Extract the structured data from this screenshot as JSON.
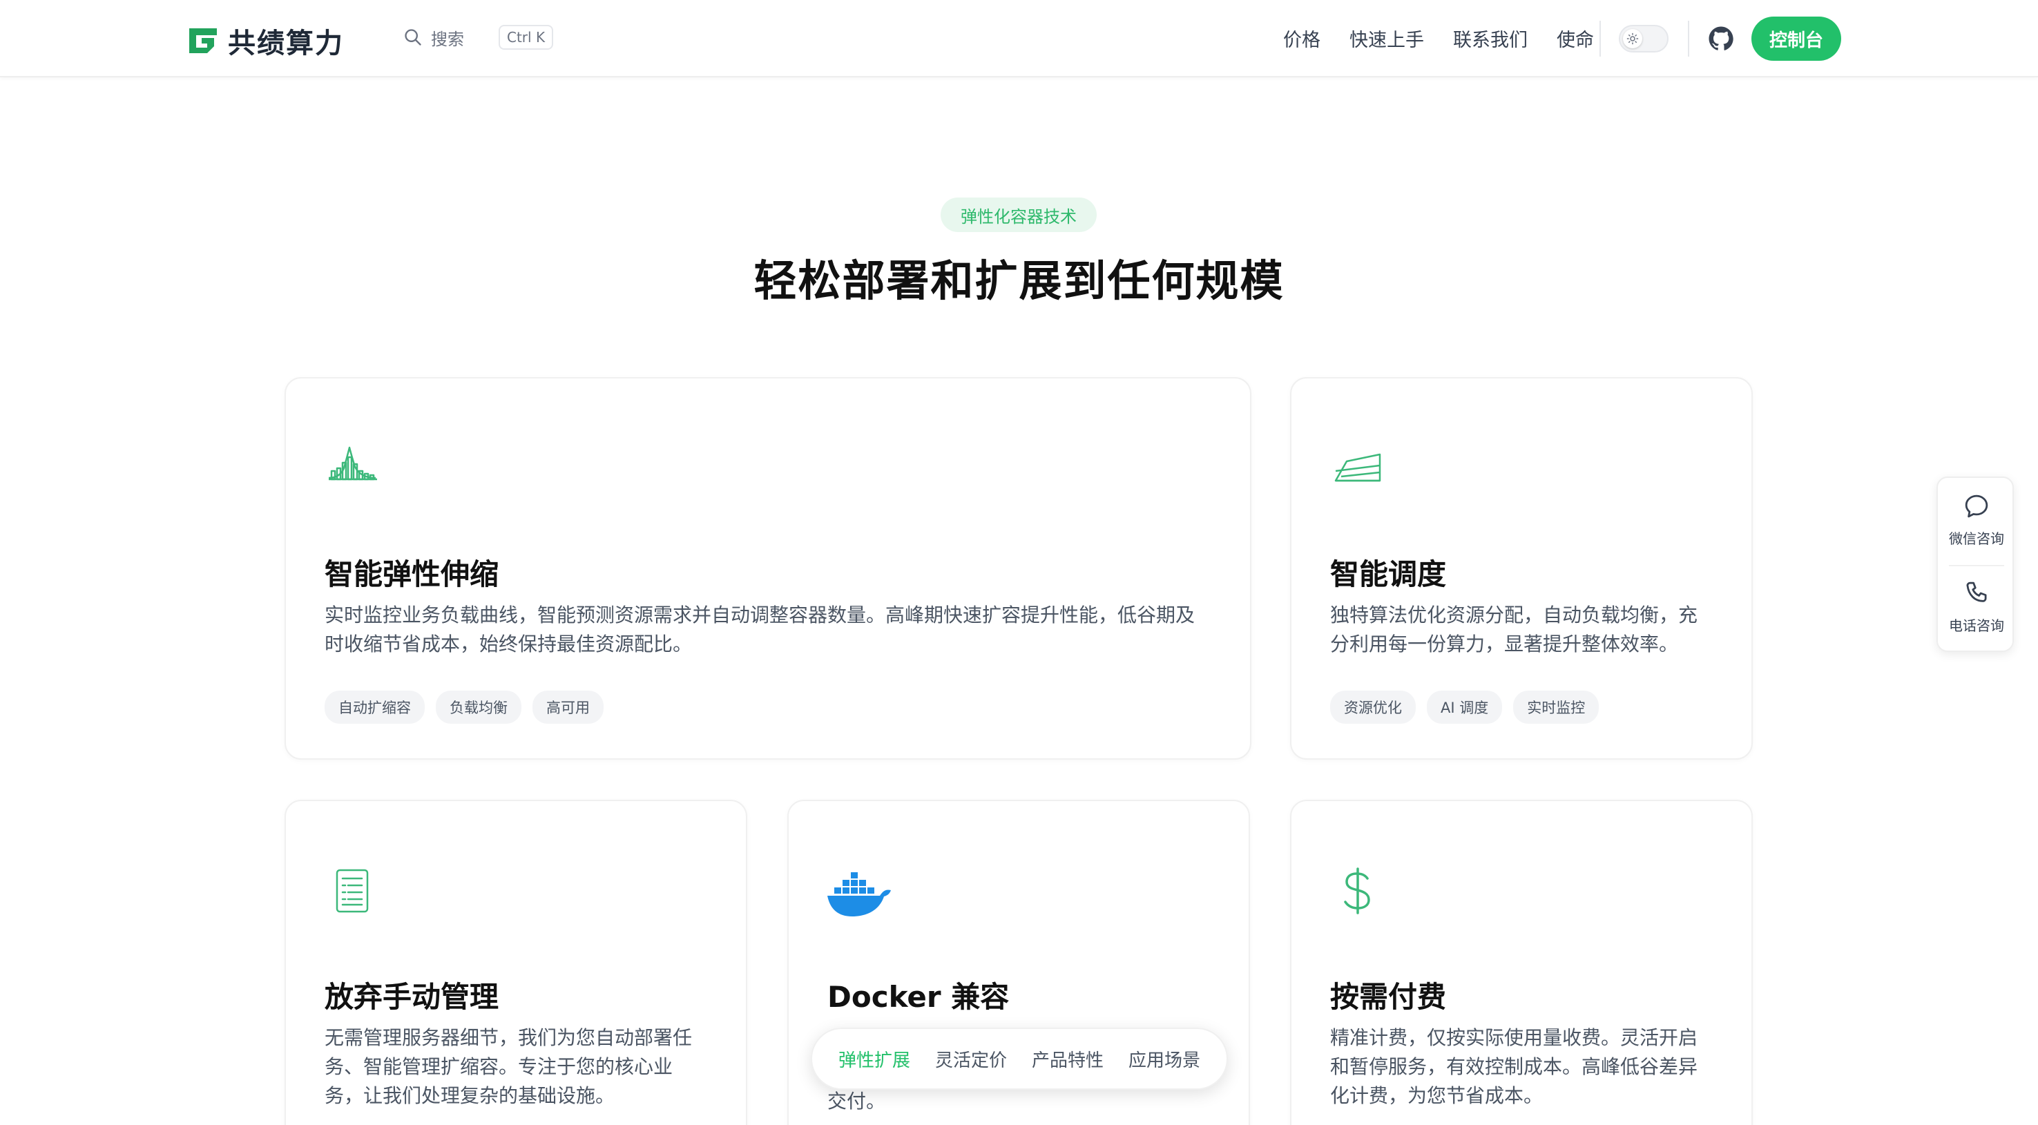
{
  "header": {
    "brand": "共绩算力",
    "search_label": "搜索",
    "search_shortcut": "Ctrl K",
    "nav": [
      "价格",
      "快速上手",
      "联系我们",
      "使命"
    ],
    "console_label": "控制台"
  },
  "hero": {
    "badge": "弹性化容器技术",
    "title": "轻松部署和扩展到任何规模"
  },
  "cards": [
    {
      "title": "智能弹性伸缩",
      "desc_lines": [
        "实时监控业务负载曲线，智能预测资源需求并自动调整容器数量。高峰期快速扩容提升性能，低谷期及",
        "时收缩节省成本，始终保持最佳资源配比。"
      ],
      "tags": [
        "自动扩缩容",
        "负载均衡",
        "高可用"
      ],
      "icon": "scaling-chart-icon"
    },
    {
      "title": "智能调度",
      "desc_lines": [
        "独特算法优化资源分配，自动负载均衡，充",
        "分利用每一份算力，显著提升整体效率。"
      ],
      "tags": [
        "资源优化",
        "AI 调度",
        "实时监控"
      ],
      "icon": "area-chart-icon"
    },
    {
      "title": "放弃手动管理",
      "desc_lines": [
        "无需管理服务器细节，我们为您自动部署任",
        "务、智能管理扩缩容。专注于您的核心业",
        "务，让我们处理复杂的基础设施。"
      ],
      "icon": "document-list-icon"
    },
    {
      "title": "Docker 兼容",
      "desc_lines": [
        "交付。"
      ],
      "icon": "docker-whale-icon"
    },
    {
      "title": "按需付费",
      "desc_lines": [
        "精准计费，仅按实际使用量收费。灵活开启",
        "和暂停服务，有效控制成本。高峰低谷差异",
        "化计费，为您节省成本。"
      ],
      "icon": "dollar-icon"
    }
  ],
  "float_tabs": [
    "弹性扩展",
    "灵活定价",
    "产品特性",
    "应用场景"
  ],
  "side_widget": {
    "wechat": "微信咨询",
    "phone": "电话咨询"
  },
  "colors": {
    "brand_green": "#22c06a",
    "docker_blue": "#1d8de6"
  }
}
